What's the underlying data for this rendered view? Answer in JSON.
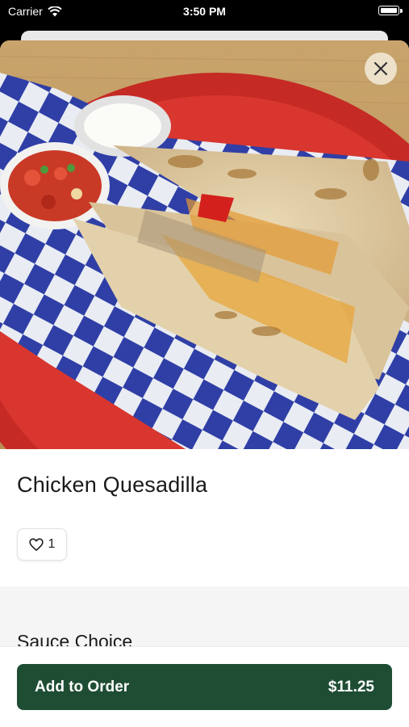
{
  "status_bar": {
    "carrier": "Carrier",
    "time": "3:50 PM"
  },
  "item": {
    "title": "Chicken Quesadilla",
    "like_count": "1",
    "image_icon": "quesadilla-photo"
  },
  "options": {
    "section_title": "Sauce Choice"
  },
  "footer": {
    "add_label": "Add to Order",
    "price": "$11.25"
  },
  "colors": {
    "accent": "#1e4d33",
    "close_bg": "#f0e6d2"
  }
}
